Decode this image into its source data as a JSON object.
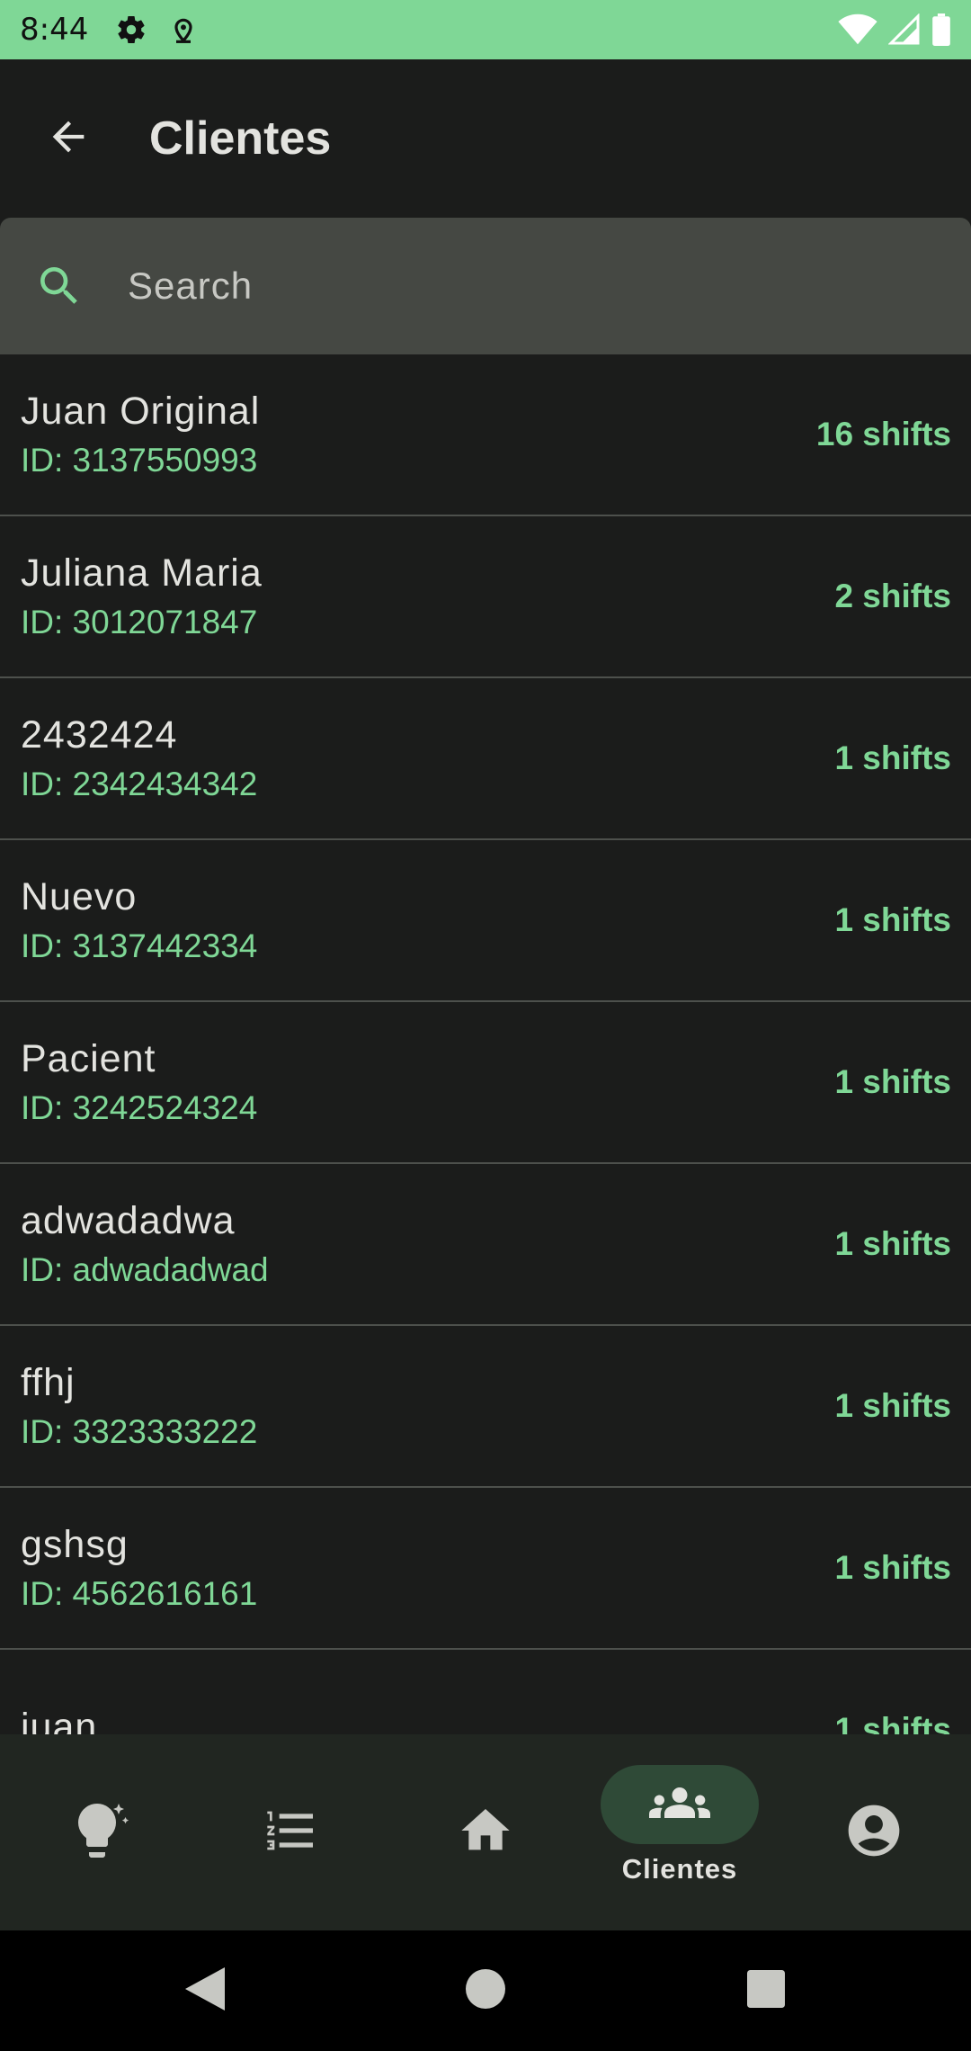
{
  "status_bar": {
    "time": "8:44",
    "left_icons": [
      "gear-icon",
      "location-icon"
    ],
    "right_icons": [
      "wifi-icon",
      "signal-icon",
      "battery-icon"
    ],
    "background_color": "#7fd796"
  },
  "app_bar": {
    "title": "Clientes",
    "back_icon": "arrow-back-icon"
  },
  "search": {
    "placeholder": "Search",
    "value": ""
  },
  "clients": [
    {
      "name": "Juan Original",
      "id_label": "ID: 3137550993",
      "shifts_label": "16 shifts"
    },
    {
      "name": "Juliana Maria",
      "id_label": "ID: 3012071847",
      "shifts_label": "2 shifts"
    },
    {
      "name": "2432424",
      "id_label": "ID: 2342434342",
      "shifts_label": "1 shifts"
    },
    {
      "name": "Nuevo",
      "id_label": "ID: 3137442334",
      "shifts_label": "1 shifts"
    },
    {
      "name": "Pacient",
      "id_label": "ID: 3242524324",
      "shifts_label": "1 shifts"
    },
    {
      "name": "adwadadwa",
      "id_label": "ID: adwadadwad",
      "shifts_label": "1 shifts"
    },
    {
      "name": "ffhj",
      "id_label": "ID: 3323333222",
      "shifts_label": "1 shifts"
    },
    {
      "name": "gshsg",
      "id_label": "ID: 4562616161",
      "shifts_label": "1 shifts"
    },
    {
      "name": "juan",
      "id_label": "",
      "shifts_label": "1 shifts"
    }
  ],
  "bottom_nav": {
    "items": [
      {
        "icon": "lightbulb-sparkle-icon",
        "label": ""
      },
      {
        "icon": "numbered-list-icon",
        "label": ""
      },
      {
        "icon": "home-icon",
        "label": ""
      },
      {
        "icon": "group-icon",
        "label": "Clientes",
        "active": true
      },
      {
        "icon": "account-circle-icon",
        "label": ""
      }
    ]
  },
  "system_nav": {
    "icons": [
      "back-triangle-icon",
      "home-circle-icon",
      "recents-square-icon"
    ]
  },
  "colors": {
    "accent": "#7fd796",
    "background": "#1b1c1b",
    "search_bg": "#454843",
    "nav_bg": "#212621",
    "active_pill": "#2f4a37"
  }
}
